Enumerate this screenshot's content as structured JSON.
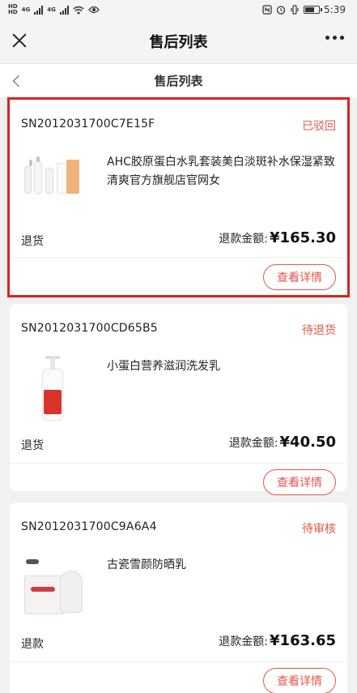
{
  "status_bar": {
    "left_badges": [
      "HD",
      "4G",
      "4G"
    ],
    "time": "5:39"
  },
  "top_bar": {
    "title": "售后列表"
  },
  "page_header": {
    "title": "售后列表"
  },
  "orders": [
    {
      "order_no": "SN2012031700C7E15F",
      "status": "已驳回",
      "product_name": "AHC胶原蛋白水乳套装美白淡斑补水保湿紧致清爽官方旗舰店官网女",
      "type": "退货",
      "amount_label": "退款金额:",
      "amount_value": "¥165.30",
      "button_label": "查看详情",
      "thumbnail": "skincare-set-image"
    },
    {
      "order_no": "SN2012031700CD65B5",
      "status": "待退货",
      "product_name": "小蛋白营养滋润洗发乳",
      "type": "退货",
      "amount_label": "退款金额:",
      "amount_value": "¥40.50",
      "button_label": "查看详情",
      "thumbnail": "shampoo-pump-bottle-image"
    },
    {
      "order_no": "SN2012031700C9A6A4",
      "status": "待审核",
      "product_name": "古瓷雪颜防晒乳",
      "type": "退款",
      "amount_label": "退款金额:",
      "amount_value": "¥163.65",
      "button_label": "查看详情",
      "thumbnail": "sunscreen-box-image"
    }
  ],
  "colors": {
    "accent": "#e2574c",
    "highlight_border": "#e0201d"
  }
}
